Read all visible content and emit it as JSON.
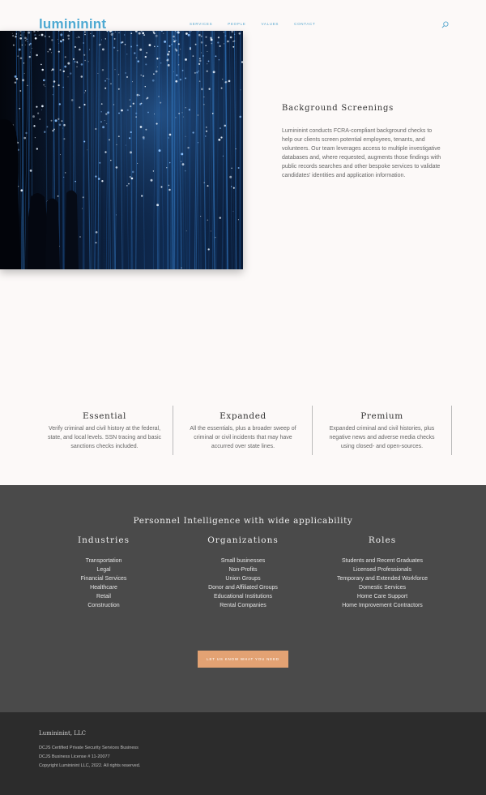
{
  "brand": {
    "logo": "lumininint",
    "accent_color": "#4faad3"
  },
  "nav": {
    "items": [
      {
        "label": "SERVICES"
      },
      {
        "label": "PEOPLE"
      },
      {
        "label": "VALUES"
      },
      {
        "label": "CONTACT"
      }
    ],
    "search_icon": "search-icon"
  },
  "hero": {
    "image": "night-light-installation-photo"
  },
  "screenings": {
    "title": "Background Screenings",
    "body": "Lumininint conducts FCRA-compliant background checks to help our clients screen potential employees, tenants, and volunteers. Our team leverages access to multiple investigative databases and, where requested, augments those findings with public records searches and other bespoke services to validate candidates' identities and application information."
  },
  "tiers": [
    {
      "name": "Essential",
      "description": "Verify criminal and civil history at the federal, state, and local levels. SSN tracing and basic sanctions checks included."
    },
    {
      "name": "Expanded",
      "description": "All the essentials, plus a broader sweep of criminal or civil incidents that may have accurred over state lines."
    },
    {
      "name": "Premium",
      "description": "Expanded criminal and civil histories, plus negative news and adverse media checks using closed- and open-sources."
    }
  ],
  "applicability": {
    "headline": "Personnel Intelligence with wide applicability",
    "columns": [
      {
        "title": "Industries",
        "items": [
          "Transportation",
          "Legal",
          "Financial Services",
          "Healthcare",
          "Retail",
          "Construction"
        ]
      },
      {
        "title": "Organizations",
        "items": [
          "Small businesses",
          "Non-Profits",
          "Union Groups",
          "Donor and Affiliated Groups",
          "Educational Institutions",
          "Rental Companies"
        ]
      },
      {
        "title": "Roles",
        "items": [
          "Students and Recent Graduates",
          "Licensed Professionals",
          "Temporary and Extended Workforce",
          "Domestic Services",
          "Home Care Support",
          "Home Improvement Contractors"
        ]
      }
    ],
    "cta_label": "LET US KNOW WHAT YOU NEED",
    "background_color": "#4a4a4a",
    "cta_color": "#e3a273"
  },
  "footer": {
    "company": "Lumininint, LLC",
    "lines": [
      "DCJS Certified Private Security Services Business",
      "DCJS Business License # 11-20077",
      "Copyright Lumininint LLC, 2022. All rights reserved."
    ]
  }
}
